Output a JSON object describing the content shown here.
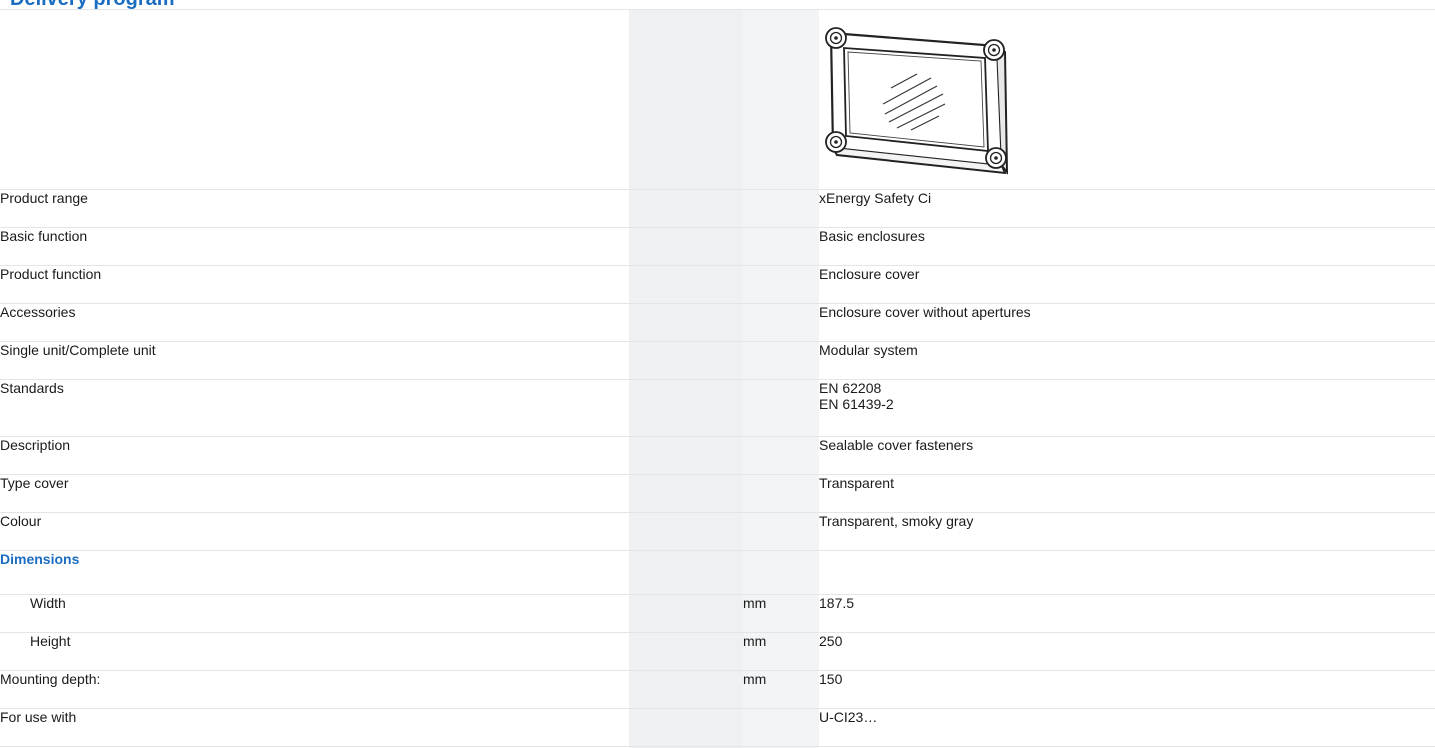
{
  "section": {
    "title": "Delivery program"
  },
  "product": {
    "image_icon": "enclosure-cover-icon"
  },
  "rows": [
    {
      "label": "Product range",
      "unit": "",
      "value": "xEnergy Safety Ci"
    },
    {
      "label": "Basic function",
      "unit": "",
      "value": "Basic enclosures"
    },
    {
      "label": "Product function",
      "unit": "",
      "value": "Enclosure cover"
    },
    {
      "label": "Accessories",
      "unit": "",
      "value": "Enclosure cover without apertures"
    },
    {
      "label": "Single unit/Complete unit",
      "unit": "",
      "value": "Modular system"
    },
    {
      "label": "Standards",
      "unit": "",
      "value_lines": [
        "EN 62208",
        "EN 61439-2"
      ]
    },
    {
      "label": "Description",
      "unit": "",
      "value": "Sealable cover fasteners"
    },
    {
      "label": "Type cover",
      "unit": "",
      "value": "Transparent"
    },
    {
      "label": "Colour",
      "unit": "",
      "value": "Transparent, smoky gray"
    }
  ],
  "dimensions": {
    "heading": "Dimensions",
    "rows": [
      {
        "label": "Width",
        "unit": "mm",
        "value": "187.5"
      },
      {
        "label": "Height",
        "unit": "mm",
        "value": "250"
      }
    ]
  },
  "extra_rows": [
    {
      "label": "Mounting depth:",
      "unit": "mm",
      "value": "150"
    },
    {
      "label": "For use with",
      "unit": "",
      "value": "U-CI23…"
    }
  ],
  "colors": {
    "accent": "#1b6dc1",
    "band_a": "#eef0f2",
    "band_b": "#f3f4f6",
    "divider": "#e3e5e8"
  }
}
